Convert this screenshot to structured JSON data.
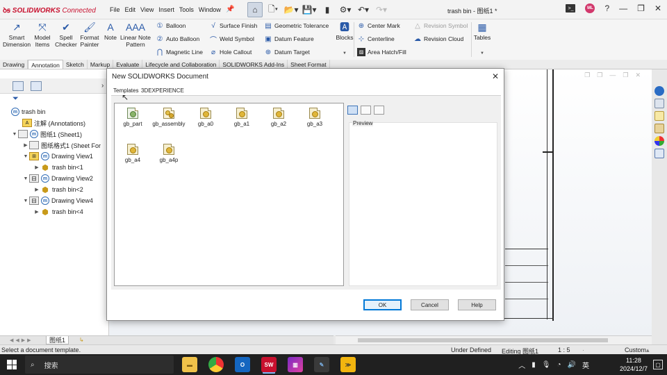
{
  "app": {
    "logo_brand": "SOLIDWORKS",
    "logo_suffix": "Connected",
    "doc_title": "trash bin - 图纸1 *"
  },
  "menu": [
    "File",
    "Edit",
    "View",
    "Insert",
    "Tools",
    "Window"
  ],
  "ribbon": {
    "smart_dimension": "Smart Dimension",
    "model_items": "Model Items",
    "spell_checker": "Spell Checker",
    "format_painter": "Format Painter",
    "note": "Note",
    "linear_note_pattern": "Linear Note Pattern",
    "balloon": "Balloon",
    "auto_balloon": "Auto Balloon",
    "magnetic_line": "Magnetic Line",
    "surface_finish": "Surface Finish",
    "weld_symbol": "Weld Symbol",
    "hole_callout": "Hole Callout",
    "geometric_tolerance": "Geometric Tolerance",
    "datum_feature": "Datum Feature",
    "datum_target": "Datum Target",
    "blocks": "Blocks",
    "center_mark": "Center Mark",
    "centerline": "Centerline",
    "area_hatch": "Area Hatch/Fill",
    "revision_symbol": "Revision Symbol",
    "revision_cloud": "Revision Cloud",
    "tables": "Tables"
  },
  "command_tabs": [
    "Drawing",
    "Annotation",
    "Sketch",
    "Markup",
    "Evaluate",
    "Lifecycle and Collaboration",
    "SOLIDWORKS Add-Ins",
    "Sheet Format"
  ],
  "tree": {
    "root": "trash bin",
    "annotations": "注解 (Annotations)",
    "sheet": "图纸1 (Sheet1)",
    "sheet_format": "图纸格式1 (Sheet For",
    "view1": "Drawing View1",
    "view1_part": "trash bin<1",
    "view2": "Drawing View2",
    "view2_part": "trash bin<2",
    "view4": "Drawing View4",
    "view4_part": "trash bin<4"
  },
  "sheet_tab": "图纸1",
  "dialog": {
    "title": "New SOLIDWORKS Document",
    "tabs": [
      "Templates",
      "3DEXPERIENCE"
    ],
    "templates": [
      "gb_part",
      "gb_assembly",
      "gb_a0",
      "gb_a1",
      "gb_a2",
      "gb_a3",
      "gb_a4",
      "gb_a4p"
    ],
    "preview_label": "Preview",
    "ok": "OK",
    "cancel": "Cancel",
    "help": "Help"
  },
  "status": {
    "hint": "Select a document template.",
    "state": "Under Defined",
    "editing": "Editing 图纸1",
    "scale": "1 : 5",
    "units": "Custom"
  },
  "taskbar": {
    "search_placeholder": "搜索",
    "ime": "英",
    "time": "11:28",
    "date": "2024/12/7"
  },
  "colors": {
    "brand": "#c8102e",
    "accent": "#0078d7",
    "taskbar": "#202020"
  }
}
